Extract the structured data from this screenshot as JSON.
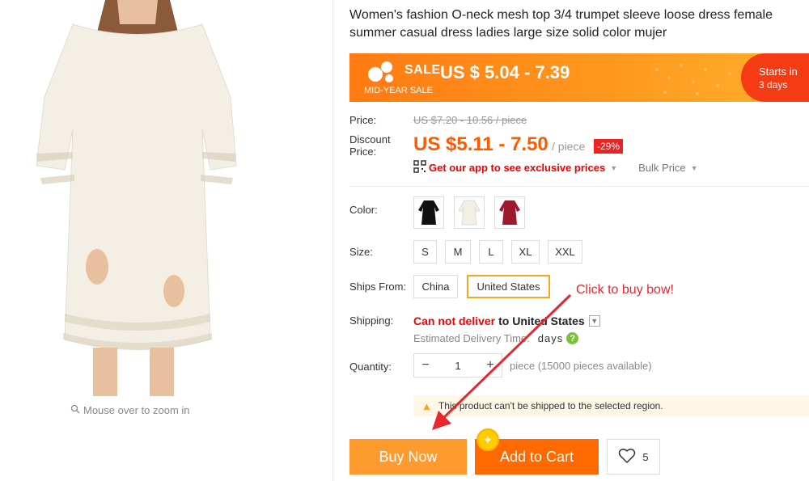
{
  "product": {
    "title": "Women's fashion O-neck mesh top 3/4 trumpet sleeve loose dress female summer casual dress ladies large size solid color mujer",
    "zoom_hint": "Mouse over to zoom in"
  },
  "sale": {
    "word": "SALE",
    "price": "US $ 5.04 - 7.39",
    "event": "MID-YEAR SALE",
    "starts_label": "Starts in",
    "starts_value": "3 days"
  },
  "pricing": {
    "price_label": "Price:",
    "original": "US $7.20 - 10.56 / piece",
    "discount_label_1": "Discount",
    "discount_label_2": "Price:",
    "discount": "US $5.11 - 7.50",
    "unit": "/ piece",
    "off": "-29%",
    "app_prompt": "Get our app to see exclusive prices",
    "bulk": "Bulk Price"
  },
  "options": {
    "color_label": "Color:",
    "colors": [
      "black",
      "white",
      "burgundy"
    ],
    "size_label": "Size:",
    "sizes": [
      "S",
      "M",
      "L",
      "XL",
      "XXL"
    ],
    "ships_from_label": "Ships From:",
    "ships_from": [
      "China",
      "United States"
    ],
    "ships_from_selected": "United States"
  },
  "shipping": {
    "label": "Shipping:",
    "status": "Can not deliver",
    "destination": "to United States",
    "estimate_label": "Estimated Delivery Time:",
    "estimate_value": "days"
  },
  "quantity": {
    "label": "Quantity:",
    "minus": "−",
    "value": "1",
    "plus": "+",
    "available": "piece (15000 pieces available)"
  },
  "warning": "This product can't be shipped to the selected region.",
  "actions": {
    "buy_now": "Buy Now",
    "add_to_cart": "Add to Cart",
    "wishlist_count": "5"
  },
  "annotation": "Click to buy bow!",
  "colors": {
    "accent": "#ff6a00",
    "sale_orange": "#ff9a1f",
    "red": "#e22222",
    "selected_border": "#f5a623"
  }
}
